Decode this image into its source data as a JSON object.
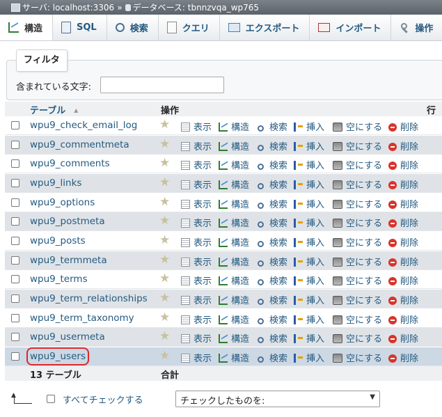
{
  "breadcrumb": {
    "server": "サーバ: localhost:3306",
    "separator": "»",
    "database": "データベース: tbnnzvqa_wp765"
  },
  "tabs": [
    {
      "label": "構造",
      "icon": "structure-icon",
      "active": true
    },
    {
      "label": "SQL",
      "icon": "sql-icon"
    },
    {
      "label": "検索",
      "icon": "search-icon"
    },
    {
      "label": "クエリ",
      "icon": "query-icon"
    },
    {
      "label": "エクスポート",
      "icon": "export-icon"
    },
    {
      "label": "インポート",
      "icon": "import-icon"
    },
    {
      "label": "操作",
      "icon": "wrench-icon"
    }
  ],
  "filter": {
    "legend": "フィルタ",
    "label": "含まれている文字:",
    "value": ""
  },
  "table": {
    "col_table": "テーブル",
    "col_actions": "操作",
    "col_rows": "行",
    "actions": {
      "browse": "表示",
      "structure": "構造",
      "search": "検索",
      "insert": "挿入",
      "empty": "空にする",
      "drop": "削除"
    },
    "rows": [
      {
        "name": "wpu9_check_email_log"
      },
      {
        "name": "wpu9_commentmeta"
      },
      {
        "name": "wpu9_comments"
      },
      {
        "name": "wpu9_links"
      },
      {
        "name": "wpu9_options"
      },
      {
        "name": "wpu9_postmeta"
      },
      {
        "name": "wpu9_posts"
      },
      {
        "name": "wpu9_termmeta"
      },
      {
        "name": "wpu9_terms"
      },
      {
        "name": "wpu9_term_relationships"
      },
      {
        "name": "wpu9_term_taxonomy"
      },
      {
        "name": "wpu9_usermeta"
      },
      {
        "name": "wpu9_users",
        "highlighted": true
      }
    ],
    "footer_count": "13 テーブル",
    "footer_sum": "合計"
  },
  "bottom": {
    "check_all": "すべてチェックする",
    "with_selected": "チェックしたものを:"
  },
  "colors": {
    "link": "#235a81",
    "highlight": "#e0262b",
    "row_even": "#dfe3e7",
    "row_selected": "#ccd8e4"
  }
}
